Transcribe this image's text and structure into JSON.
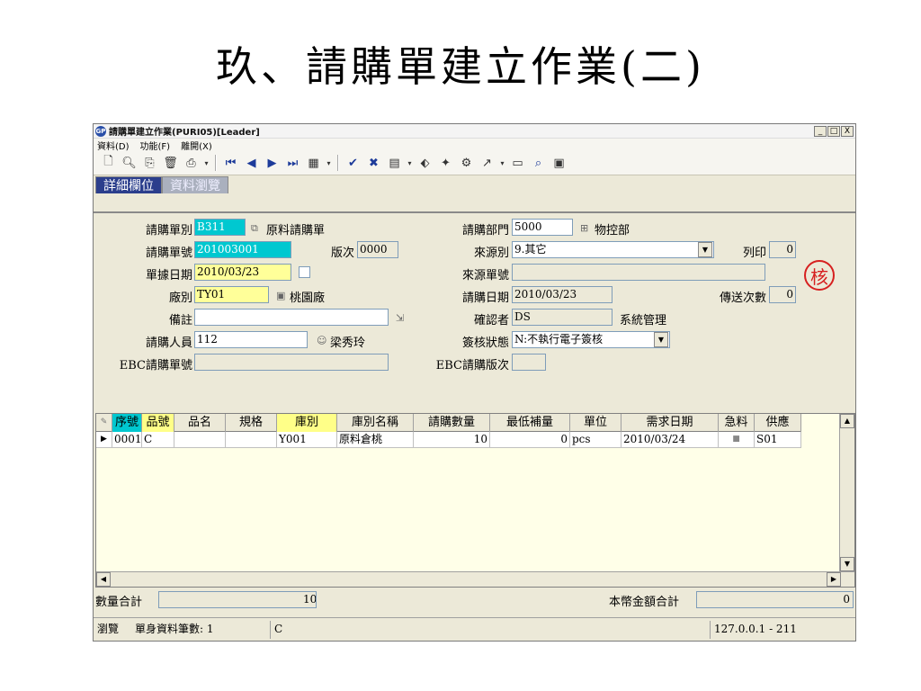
{
  "slide_title": "玖、請購單建立作業(二)",
  "window": {
    "title": "請購單建立作業(PURI05)[Leader]",
    "app_icon": "GP",
    "minimize": "_",
    "maximize": "□",
    "close": "X"
  },
  "menu": [
    "資料(D)",
    "功能(F)",
    "離開(X)"
  ],
  "toolbar_icons": [
    "new-icon",
    "preview-icon",
    "copy-icon",
    "delete-icon",
    "print-icon",
    "first-icon",
    "prev-icon",
    "next-icon",
    "last-icon",
    "view-icon",
    "confirm-icon",
    "cancel-icon",
    "tools-icon",
    "attach-icon",
    "approve-icon",
    "filter-icon",
    "chart-icon",
    "folder-icon",
    "search-icon",
    "clipboard-icon"
  ],
  "tabs": [
    "詳細欄位",
    "資料瀏覽"
  ],
  "form": {
    "req_type_label": "請購單別",
    "req_type_value": "B311",
    "req_type_desc": "原料請購單",
    "req_no_label": "請購單號",
    "req_no_value": "201003001",
    "version_label": "版次",
    "version_value": "0000",
    "doc_date_label": "單據日期",
    "doc_date_value": "2010/03/23",
    "plant_label": "廠別",
    "plant_value": "TY01",
    "plant_desc": "桃園廠",
    "remark_label": "備註",
    "remark_value": "",
    "requester_label": "請購人員",
    "requester_value": "112",
    "requester_name": "梁秀玲",
    "ebc_no_label": "EBC請購單號",
    "ebc_no_value": "",
    "dept_label": "請購部門",
    "dept_value": "5000",
    "dept_desc": "物控部",
    "source_label": "來源別",
    "source_value": "9.其它",
    "print_label": "列印",
    "print_value": "0",
    "source_no_label": "來源單號",
    "source_no_value": "",
    "req_date_label": "請購日期",
    "req_date_value": "2010/03/23",
    "send_count_label": "傳送次數",
    "send_count_value": "0",
    "confirmer_label": "確認者",
    "confirmer_value": "DS",
    "confirmer_name": "系統管理",
    "sign_status_label": "簽核狀態",
    "sign_status_value": "N:不執行電子簽核",
    "ebc_ver_label": "EBC請購版次",
    "ebc_ver_value": "",
    "stamp_text": "核"
  },
  "grid": {
    "columns": [
      "序號",
      "品號",
      "品名",
      "規格",
      "庫別",
      "庫別名稱",
      "請購數量",
      "最低補量",
      "單位",
      "需求日期",
      "急料",
      "供應"
    ],
    "rows": [
      [
        "0001",
        "C",
        "",
        "",
        "Y001",
        "原料倉桃",
        "10",
        "0",
        "pcs",
        "2010/03/24",
        "",
        "S01"
      ]
    ]
  },
  "summary": {
    "qty_total_label": "數量合計",
    "qty_total_value": "10",
    "amount_total_label": "本幣金額合計",
    "amount_total_value": "0"
  },
  "status": {
    "mode": "瀏覽",
    "record_count": "單身資料筆數: 1",
    "current": "C",
    "server": "127.0.0.1 - 211"
  }
}
